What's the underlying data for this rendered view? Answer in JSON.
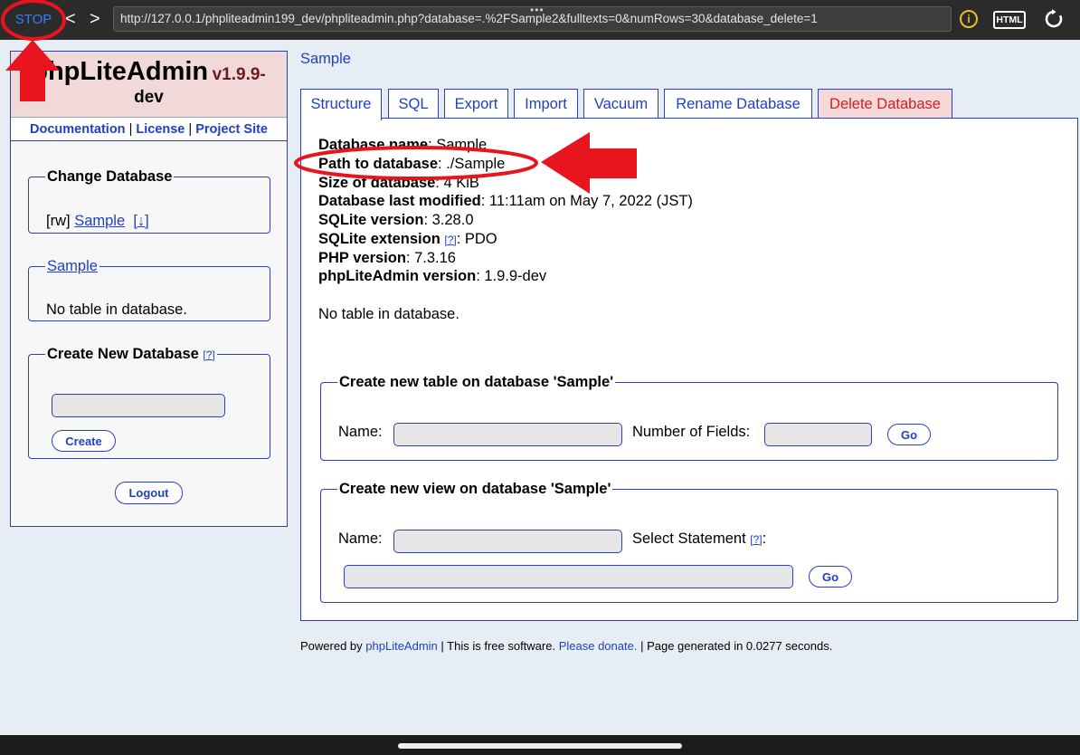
{
  "browser": {
    "stop_label": "STOP",
    "back_label": "<",
    "forward_label": ">",
    "url": "http://127.0.0.1/phpliteadmin199_dev/phpliteadmin.php?database=.%2FSample2&fulltexts=0&numRows=30&database_delete=1",
    "drag_handle": "•••",
    "info_icon": "i",
    "html_icon": "HTML",
    "reload_icon": "reload-icon"
  },
  "sidebar": {
    "logo": {
      "name": "phpLiteAdmin",
      "version_a": "v1.9.9-",
      "version_b": "dev"
    },
    "links": {
      "documentation": "Documentation",
      "license": "License",
      "project_site": "Project Site",
      "separator": "|"
    },
    "change_db": {
      "legend": "Change Database",
      "mode": "[rw]",
      "db_link": "Sample",
      "download": "[↓]"
    },
    "sample_box": {
      "legend": "Sample",
      "text": "No table in database."
    },
    "create_db": {
      "legend": "Create New Database",
      "help": "[?]",
      "input_value": "",
      "button": "Create"
    },
    "logout": "Logout"
  },
  "main": {
    "breadcrumb": "Sample",
    "tabs": [
      {
        "label": "Structure"
      },
      {
        "label": "SQL"
      },
      {
        "label": "Export"
      },
      {
        "label": "Import"
      },
      {
        "label": "Vacuum"
      },
      {
        "label": "Rename Database"
      },
      {
        "label": "Delete Database"
      }
    ],
    "info": [
      {
        "label": "Database name",
        "value": ": Sample"
      },
      {
        "label": "Path to database",
        "value": ": ./Sample"
      },
      {
        "label": "Size of database",
        "value": ": 4 KiB"
      },
      {
        "label": "Database last modified",
        "value": ": 11:11am on May 7, 2022 (JST)"
      },
      {
        "label": "SQLite version",
        "value": ": 3.28.0"
      },
      {
        "label": "SQLite extension",
        "help": "[?]",
        "value": ": PDO"
      },
      {
        "label": "PHP version",
        "value": ": 7.3.16"
      },
      {
        "label": "phpLiteAdmin version",
        "value": ": 1.9.9-dev"
      }
    ],
    "no_table": "No table in database.",
    "create_table": {
      "legend": "Create new table on database 'Sample'",
      "name_label": "Name:",
      "fields_label": "Number of Fields:",
      "go": "Go"
    },
    "create_view": {
      "legend": "Create new view on database 'Sample'",
      "name_label": "Name:",
      "statement_label": "Select Statement",
      "help": "[?]",
      "colon": ":",
      "go": "Go"
    }
  },
  "footer": {
    "powered": "Powered by",
    "app_link": "phpLiteAdmin",
    "free": "| This is free software.",
    "donate": "Please donate.",
    "generated": "| Page generated in 0.0277 seconds."
  },
  "colors": {
    "accent_blue": "#1f3fc8",
    "annotation_red": "#e8141e",
    "danger_tab_bg": "#f5d9d9"
  }
}
